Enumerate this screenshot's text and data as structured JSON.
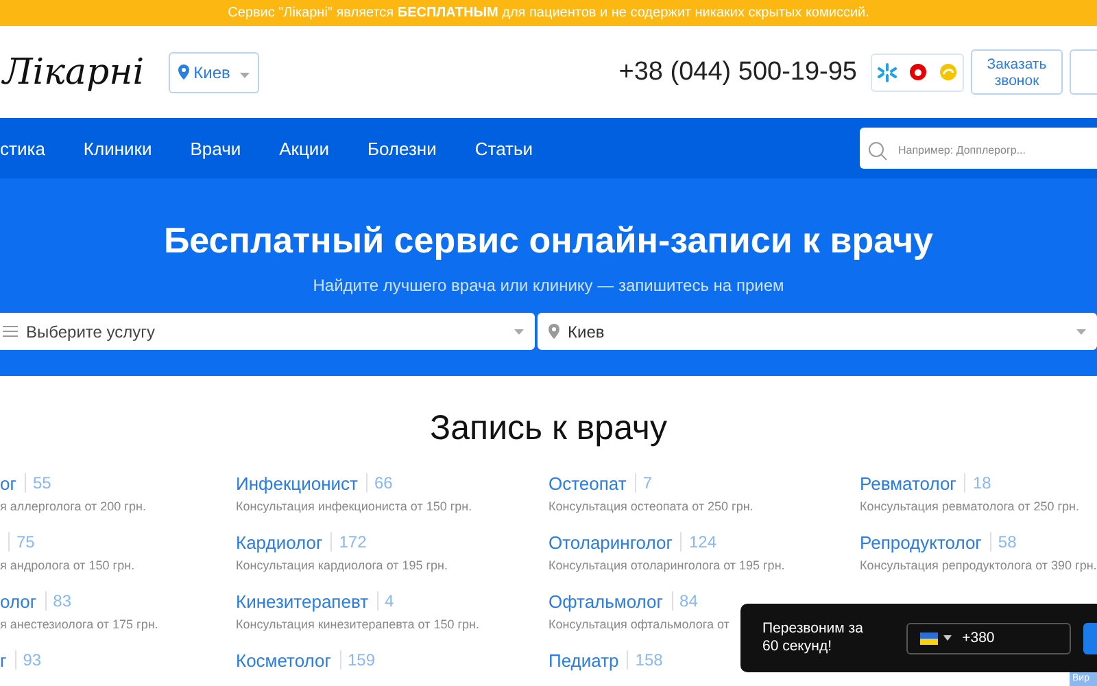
{
  "banner": {
    "text": "Сервис \"Лікарні\" является **БЕСПЛАТНЫМ** для пациентов и не содержит никаких скрытых комиссий."
  },
  "header": {
    "logo": "Лікарні",
    "city": "Киев",
    "phone": "+38 (044) 500-19-95",
    "callback_button": "Заказать звонок"
  },
  "nav": {
    "items": [
      "стика",
      "Клиники",
      "Врачи",
      "Акции",
      "Болезни",
      "Статьи"
    ],
    "search": {
      "placeholder": "Например: Допплерогр..."
    }
  },
  "hero": {
    "title": "Бесплатный сервис онлайн-записи к врачу",
    "subtitle": "Найдите лучшего врача или клинику — запишитесь на прием",
    "service_select": {
      "placeholder": "Выберите услугу"
    },
    "city_select": {
      "value": "Киев"
    }
  },
  "section": {
    "title": "Запись к врачу",
    "columns": [
      [
        {
          "name": "ог",
          "count": "55",
          "desc": "я аллерголога от 200 грн."
        },
        {
          "count": "75",
          "desc": "я андролога от 150 грн."
        },
        {
          "name": "олог",
          "count": "83",
          "desc": "я анестезиолога от 175 грн."
        },
        {
          "name": "г",
          "count": "93"
        }
      ],
      [
        {
          "name": "Инфекционист",
          "count": "66",
          "desc": "Консультация инфекциониста от 150 грн."
        },
        {
          "name": "Кардиолог",
          "count": "172",
          "desc": "Консультация кардиолога от 195 грн."
        },
        {
          "name": "Кинезитерапевт",
          "count": "4",
          "desc": "Консультация кинезитерапевта от 150 грн."
        },
        {
          "name": "Косметолог",
          "count": "159"
        }
      ],
      [
        {
          "name": "Остеопат",
          "count": "7",
          "desc": "Консультация остеопата от 250 грн."
        },
        {
          "name": "Отоларинголог",
          "count": "124",
          "desc": "Консультация отоларинголога от 195 грн."
        },
        {
          "name": "Офтальмолог",
          "count": "84",
          "desc": "Консультация офтальмолога от"
        },
        {
          "name": "Педиатр",
          "count": "158"
        }
      ],
      [
        {
          "name": "Ревматолог",
          "count": "18",
          "desc": "Консультация ревматолога от 250 грн."
        },
        {
          "name": "Репродуктолог",
          "count": "58",
          "desc": "Консультация репродуктолога от 390 грн."
        }
      ]
    ]
  },
  "callback_popup": {
    "text": "Перезвоним за 60 секунд!",
    "phone_value": "+380"
  },
  "side_tab": "Вир"
}
